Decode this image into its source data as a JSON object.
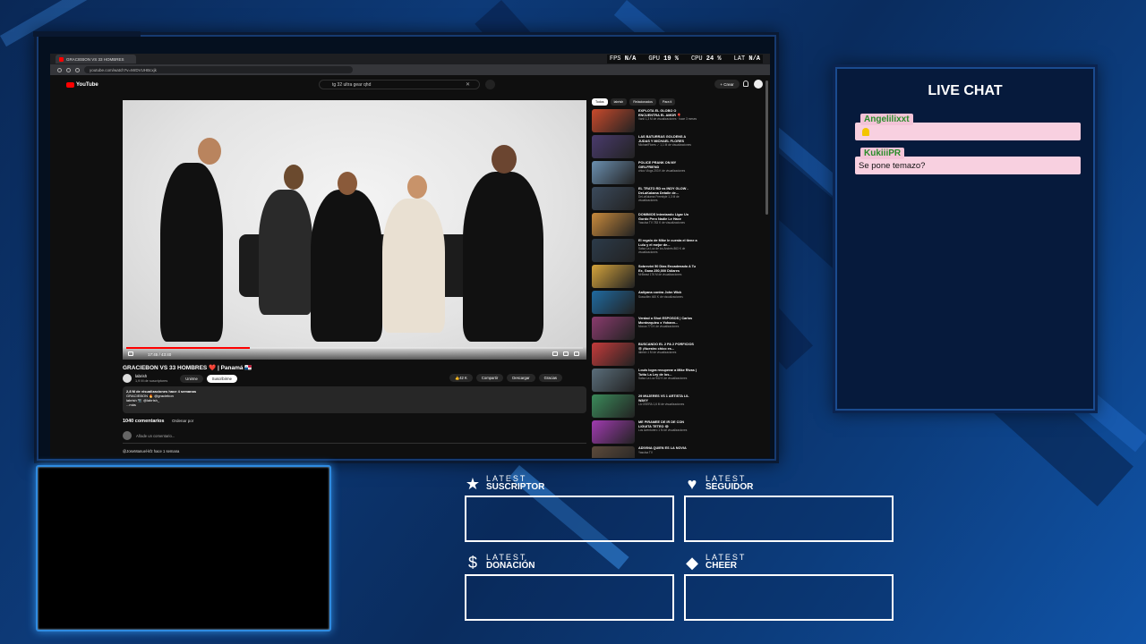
{
  "browser": {
    "tab_title": "GRACIEBON VS 33 HOMBRES",
    "url": "youtube.com/watch?v=MrDVUHBcxjk"
  },
  "perf_stats": {
    "fps_label": "FPS",
    "fps_value": "N/A",
    "gpu_label": "GPU",
    "gpu_value": "19 %",
    "cpu_label": "CPU",
    "cpu_value": "24 %",
    "lat_label": "LAT",
    "lat_value": "N/A"
  },
  "youtube": {
    "logo_text": "YouTube",
    "search_query": "tg 32 ultra gear qhd",
    "create_label": "+ Crear",
    "video_time": "17:45 / 43:40",
    "video_title": "GRACIEBON VS 33 HOMBRES ❤️ | Panamá 🇵🇦",
    "channel_name": "labrish",
    "channel_subs": "1,9 M de suscriptores",
    "join_label": "Unirme",
    "subscribe_label": "Suscribirme",
    "likes": "42 K",
    "share_label": "Compartir",
    "download_label": "Descargar",
    "thanks_label": "Gracias",
    "desc_line1": "2,8 M de visualizaciones  hace 4 semanas",
    "desc_line2": "GRACIEBON 🔥 @graciebon",
    "desc_line3": "labrish 📷 @labrish_",
    "desc_more": "...más",
    "comments_count": "1040 comentarios",
    "sort_label": "Ordenar por",
    "add_comment": "Añade un comentario...",
    "first_comment": "@JoseManuel-kfz  hace 1 semana",
    "chips": [
      "Todos",
      "labrish",
      "Relacionados",
      "Para ti"
    ],
    "recommendations": [
      {
        "title": "EXPLOTA EL GLOBO O ENCUENTRA EL AMOR 🎈",
        "meta": "Vanil 1,3 M de visualizaciones · hace 3 meses"
      },
      {
        "title": "LAS BATURRAS GOLDENS A JUDAS Y MICHAEL FLORES",
        "meta": "MichaelFlores ✓ 1,1 M de visualizaciones"
      },
      {
        "title": "POLICE PRANK ON MY GIRLFRIEND",
        "meta": "chico Vlogs 203 K de visualizaciones"
      },
      {
        "title": "EL TRATO RD vs INDY GLOW - DeLaKalama Detalle de...",
        "meta": "DeLaKalama Freestyle 1,3 M de visualizaciones"
      },
      {
        "title": "DOMINIOS Intentando Ligar Un Gordo Pero Nadie Le Hace",
        "meta": "Yasulsa TV 783 K de visualizaciones"
      },
      {
        "title": "El regalo de Mike le cuesta el tiene a Lulu y el mejor de...",
        "meta": "Salsa La Luz de los Andrés 863 K de visualizaciones"
      },
      {
        "title": "Sobreviví 50 Días Encadenado A Tu Ex, Gana 250,000 Dólares",
        "meta": "MrBeast 176 M de visualizaciones"
      },
      {
        "title": "Aaliyana contra John Wick",
        "meta": "Sussuflex 460 K de visualizaciones"
      },
      {
        "title": "Verdad o Shot ESPOSOS | Carlos Montezquieu x Yohann...",
        "meta": "Mocca 773 K de visualizaciones"
      },
      {
        "title": "BUSCANDO EL 2 PA 2 PORFICIOS 😄 ¡Nuestro chico es...",
        "meta": "labrish 1 M de visualizaciones"
      },
      {
        "title": "Louis logra recuperar a Mike Rivas | Tuttu La Ley de los...",
        "meta": "Salsa La Luz 942 K de visualizaciones"
      },
      {
        "title": "29 MUJERES VS 1 ARTISTA LIL WAVY",
        "meta": "LA OSERA 1,6 M de visualizaciones"
      },
      {
        "title": "ME PIRAMEE DE IR DE CON LIGUITA TETEO 😂",
        "meta": "Los Aventurero 1 M de visualizaciones"
      },
      {
        "title": "ADIVINA QUIEN ES LA NOVIA",
        "meta": "Yasulsa TV"
      }
    ]
  },
  "chat": {
    "title": "LIVE CHAT",
    "messages": [
      {
        "user": "Angelilixxt",
        "text": ""
      },
      {
        "user": "KukiiiPR",
        "text": "Se pone temazo?"
      }
    ]
  },
  "latest": {
    "latest_word": "LATEST",
    "suscriptor": "SUSCRIPTOR",
    "seguidor": "SEGUIDOR",
    "donacion": "DONACIÓN",
    "cheer": "CHEER"
  },
  "colors": {
    "accent_red": "#ff0000",
    "chat_bubble": "#f8d0e0",
    "username_green": "#2a8d2a",
    "background_blue": "#0d3a78"
  }
}
